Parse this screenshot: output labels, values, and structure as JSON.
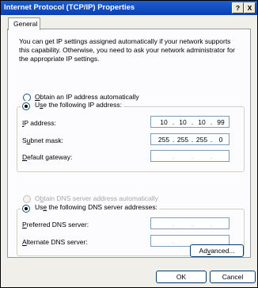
{
  "window": {
    "title": "Internet Protocol (TCP/IP) Properties",
    "help_label": "?",
    "close_label": "X"
  },
  "tabs": [
    {
      "label": "General",
      "selected": true
    }
  ],
  "intro_text": "You can get IP settings assigned automatically if your network supports this capability. Otherwise, you need to ask your network administrator for the appropriate IP settings.",
  "ip_mode": {
    "auto_label": "Obtain an IP address automatically",
    "manual_label": "Use the following IP address:",
    "selected": "manual"
  },
  "ip_fields": [
    {
      "label": "IP address:",
      "octets": [
        "10",
        "10",
        "10",
        "99"
      ]
    },
    {
      "label": "Subnet mask:",
      "octets": [
        "255",
        "255",
        "255",
        "0"
      ]
    },
    {
      "label": "Default gateway:",
      "octets": [
        "",
        "",
        "",
        ""
      ]
    }
  ],
  "dns_mode": {
    "auto_label": "Obtain DNS server address automatically",
    "manual_label": "Use the following DNS server addresses:",
    "selected": "manual",
    "auto_disabled": true
  },
  "dns_fields": [
    {
      "label": "Preferred DNS server:",
      "octets": [
        "",
        "",
        "",
        ""
      ]
    },
    {
      "label": "Alternate DNS server:",
      "octets": [
        "",
        "",
        "",
        ""
      ]
    }
  ],
  "buttons": {
    "advanced": "Advanced...",
    "ok": "OK",
    "cancel": "Cancel"
  }
}
